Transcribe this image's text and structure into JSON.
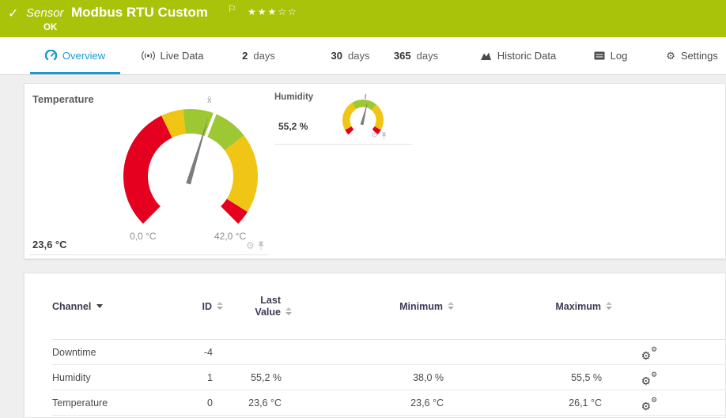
{
  "header": {
    "check_icon": "✓",
    "kind": "Sensor",
    "title": "Modbus RTU Custom",
    "flag_icon": "⚐",
    "stars": "★★★☆☆",
    "status": "OK",
    "bg_color": "#a9c30b"
  },
  "tabs": {
    "overview": "Overview",
    "live_data": "Live Data",
    "d2_num": "2",
    "d2_label": "days",
    "d30_num": "30",
    "d30_label": "days",
    "d365_num": "365",
    "d365_label": "days",
    "historic": "Historic Data",
    "log": "Log",
    "settings": "Settings",
    "active_color": "#1b9ad2"
  },
  "chart_data": [
    {
      "type": "gauge",
      "title": "Temperature",
      "value": 23.6,
      "value_label": "23,6 °C",
      "unit": "°C",
      "min": 0,
      "max": 42,
      "min_label": "0,0 °C",
      "max_label": "42,0 °C",
      "avg": 24.3,
      "avg_symbol": "x̄",
      "needle_color": "#7c7c7c",
      "segments": [
        {
          "from": 0,
          "to": 17,
          "color": "#e4001e"
        },
        {
          "from": 17,
          "to": 20,
          "color": "#f0c515"
        },
        {
          "from": 20,
          "to": 29.2,
          "color": "#9ec734"
        },
        {
          "from": 29.2,
          "to": 40,
          "color": "#f0c515"
        },
        {
          "from": 40,
          "to": 42,
          "color": "#e4001e"
        }
      ]
    },
    {
      "type": "gauge",
      "title": "Humidity",
      "value": 55.2,
      "value_label": "55,2 %",
      "unit": "%",
      "min": 0,
      "max": 100,
      "avg": 52.3,
      "needle_color": "#7c7c7c",
      "segments": [
        {
          "from": 0,
          "to": 6,
          "color": "#e4001e"
        },
        {
          "from": 6,
          "to": 38,
          "color": "#f0c515"
        },
        {
          "from": 38,
          "to": 65,
          "color": "#9ec734"
        },
        {
          "from": 65,
          "to": 94,
          "color": "#f0c515"
        },
        {
          "from": 94,
          "to": 100,
          "color": "#e4001e"
        }
      ]
    }
  ],
  "table": {
    "columns": [
      {
        "label": "Channel",
        "sort": "active-desc"
      },
      {
        "label": "ID",
        "sort": "none"
      },
      {
        "label": "Last Value",
        "sort": "none"
      },
      {
        "label": "Minimum",
        "sort": "none"
      },
      {
        "label": "Maximum",
        "sort": "none"
      }
    ],
    "rows": [
      {
        "channel": "Downtime",
        "id": "-4",
        "last": "",
        "min": "",
        "max": ""
      },
      {
        "channel": "Humidity",
        "id": "1",
        "last": "55,2 %",
        "min": "38,0 %",
        "max": "55,5 %"
      },
      {
        "channel": "Temperature",
        "id": "0",
        "last": "23,6 °C",
        "min": "23,6 °C",
        "max": "26,1 °C"
      }
    ]
  }
}
